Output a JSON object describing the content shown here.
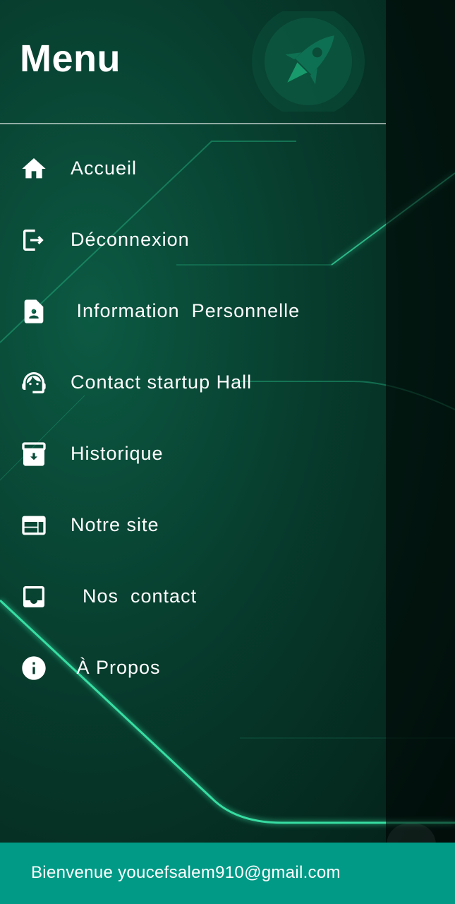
{
  "header": {
    "title": "Menu",
    "logo_icon": "rocket-icon"
  },
  "menu": {
    "items": [
      {
        "label": "Accueil",
        "icon": "home-icon"
      },
      {
        "label": "Déconnexion",
        "icon": "logout-icon"
      },
      {
        "label": " Information  Personnelle",
        "icon": "contact-page-icon"
      },
      {
        "label": "Contact startup Hall",
        "icon": "support-agent-icon"
      },
      {
        "label": "Historique",
        "icon": "archive-icon"
      },
      {
        "label": "Notre site",
        "icon": "web-icon"
      },
      {
        "label": "  Nos  contact",
        "icon": "inbox-icon"
      },
      {
        "label": " À Propos",
        "icon": "info-icon"
      }
    ]
  },
  "footer": {
    "welcome": "Bienvenue youcefsalem910@gmail.com"
  },
  "colors": {
    "accent": "#009a86",
    "text": "#ffffff",
    "glow": "#35e6a8"
  }
}
